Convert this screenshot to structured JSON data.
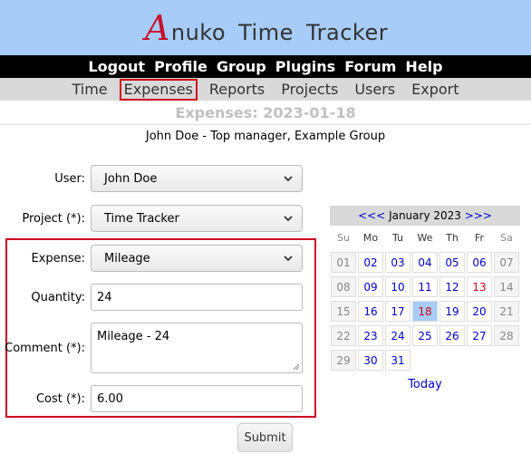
{
  "brand": {
    "first_letter": "A",
    "rest": "nuko Time Tracker"
  },
  "topnav": [
    "Logout",
    "Profile",
    "Group",
    "Plugins",
    "Forum",
    "Help"
  ],
  "subnav": [
    "Time",
    "Expenses",
    "Reports",
    "Projects",
    "Users",
    "Export"
  ],
  "page_title": "Expenses: 2023-01-18",
  "user_line": "John Doe - Top manager, Example Group",
  "form": {
    "user_label": "User:",
    "user_value": "John Doe",
    "project_label": "Project (*):",
    "project_value": "Time Tracker",
    "expense_label": "Expense:",
    "expense_value": "Mileage",
    "quantity_label": "Quantity:",
    "quantity_value": "24",
    "comment_label": "Comment (*):",
    "comment_value": "Mileage - 24",
    "cost_label": "Cost (*):",
    "cost_value": "6.00",
    "submit_label": "Submit"
  },
  "calendar": {
    "prev": "<<<",
    "month": "January 2023",
    "next": ">>>",
    "dow": [
      "Su",
      "Mo",
      "Tu",
      "We",
      "Th",
      "Fr",
      "Sa"
    ],
    "weeks": [
      [
        "01",
        "02",
        "03",
        "04",
        "05",
        "06",
        "07"
      ],
      [
        "08",
        "09",
        "10",
        "11",
        "12",
        "13",
        "14"
      ],
      [
        "15",
        "16",
        "17",
        "18",
        "19",
        "20",
        "21"
      ],
      [
        "22",
        "23",
        "24",
        "25",
        "26",
        "27",
        "28"
      ],
      [
        "29",
        "30",
        "31",
        "",
        "",
        "",
        ""
      ]
    ],
    "today_label": "Today"
  }
}
